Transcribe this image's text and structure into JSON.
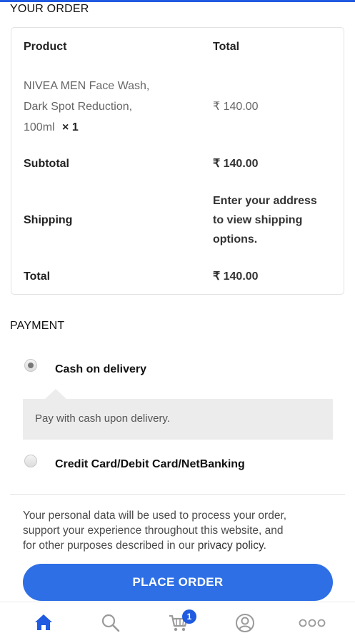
{
  "order": {
    "title": "YOUR ORDER",
    "header_product": "Product",
    "header_total": "Total",
    "item_name_line1": "NIVEA MEN Face Wash,",
    "item_name_line2": "Dark Spot Reduction,",
    "item_name_line3": "100ml",
    "item_qty": "× 1",
    "item_total": "₹ 140.00",
    "subtotal_label": "Subtotal",
    "subtotal_value": "₹ 140.00",
    "shipping_label": "Shipping",
    "shipping_line1": "Enter your address",
    "shipping_line2": "to view shipping",
    "shipping_line3": "options.",
    "total_label": "Total",
    "total_value": "₹ 140.00"
  },
  "payment": {
    "title": "PAYMENT",
    "options": [
      {
        "label": "Cash on delivery",
        "selected": true
      },
      {
        "label": "Credit Card/Debit Card/NetBanking",
        "selected": false
      }
    ],
    "cod_description": "Pay with cash upon delivery."
  },
  "privacy": {
    "line1": "Your personal data will be used to process your order,",
    "line2": "support your experience throughout this website, and",
    "line3_prefix": "for other purposes described in our ",
    "link": "privacy policy",
    "line3_suffix": "."
  },
  "place_order_label": "PLACE ORDER",
  "bottom_nav": {
    "cart_badge": "1",
    "active_color": "#1f5ae0",
    "inactive_color": "#9a9a9a",
    "icons": [
      "home-icon",
      "search-icon",
      "cart-icon",
      "account-icon",
      "more-icon"
    ]
  }
}
